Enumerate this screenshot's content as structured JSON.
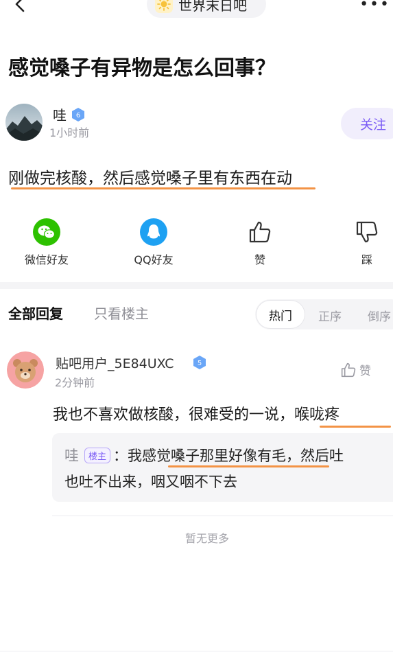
{
  "top_bar": {
    "forum_name": "世界末日吧",
    "more_label": "•••"
  },
  "post": {
    "title": "感觉嗓子有异物是怎么回事？",
    "author": {
      "name": "哇",
      "level": "6",
      "time": "1小时前"
    },
    "follow_label": "关注",
    "body": "刚做完核酸，然后感觉嗓子里有东西在动"
  },
  "actions": [
    {
      "label": "微信好友",
      "icon": "wechat-icon"
    },
    {
      "label": "QQ好友",
      "icon": "qq-icon"
    },
    {
      "label": "赞",
      "icon": "thumb-up-icon"
    },
    {
      "label": "踩",
      "icon": "thumb-down-icon"
    }
  ],
  "replies_header": {
    "tab_all": "全部回复",
    "tab_op_only": "只看楼主",
    "sort": [
      "热门",
      "正序",
      "倒序"
    ]
  },
  "reply": {
    "user": "贴吧用户_5E84UXC",
    "level": "5",
    "time": "2分钟前",
    "like_label": "赞",
    "text": "我也不喜欢做核酸，很难受的一说，喉咙疼",
    "quote": {
      "author": "哇",
      "badge": "楼主",
      "line1": "：我感觉嗓子那里好像有毛，然后吐",
      "line2": "也吐不出来，咽又咽不下去"
    }
  },
  "footer": {
    "no_more": "暂无更多"
  },
  "colors": {
    "accent": "#7b5cf5",
    "highlight": "#f39345",
    "wechat": "#2dc100",
    "qq": "#1ea1f2"
  }
}
